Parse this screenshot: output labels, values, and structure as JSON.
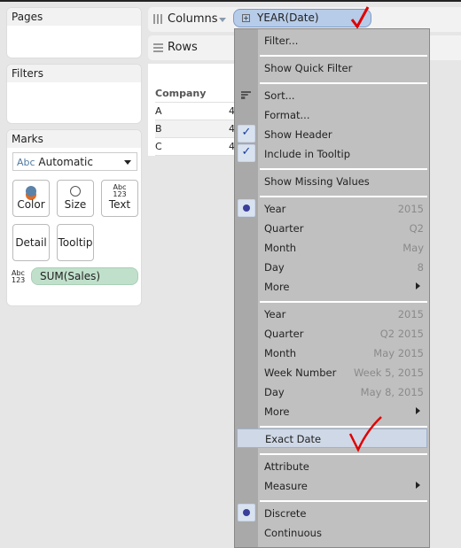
{
  "sidebar": {
    "pages": "Pages",
    "filters": "Filters",
    "marks": "Marks",
    "mark_type": "Automatic",
    "mark_type_prefix": "Abc",
    "buttons": [
      {
        "label": "Color"
      },
      {
        "label": "Size"
      },
      {
        "label": "Text",
        "icon_text": "Abc\n123"
      },
      {
        "label": "Detail"
      },
      {
        "label": "Tooltip"
      }
    ],
    "field_icon": "Abc 123",
    "field": "SUM(Sales)"
  },
  "shelves": {
    "columns": "Columns",
    "rows": "Rows",
    "column_pill": "YEAR(Date)"
  },
  "table": {
    "header": "Company",
    "rows": [
      {
        "label": "A",
        "value": "4"
      },
      {
        "label": "B",
        "value": "4"
      },
      {
        "label": "C",
        "value": "4"
      }
    ]
  },
  "menu": {
    "filter": "Filter...",
    "quick_filter": "Show Quick Filter",
    "sort": "Sort...",
    "format": "Format...",
    "show_header": "Show Header",
    "include_tooltip": "Include in Tooltip",
    "missing": "Show Missing Values",
    "parts": [
      {
        "label": "Year",
        "value": "2015"
      },
      {
        "label": "Quarter",
        "value": "Q2"
      },
      {
        "label": "Month",
        "value": "May"
      },
      {
        "label": "Day",
        "value": "8"
      },
      {
        "label": "More"
      }
    ],
    "values": [
      {
        "label": "Year",
        "value": "2015"
      },
      {
        "label": "Quarter",
        "value": "Q2 2015"
      },
      {
        "label": "Month",
        "value": "May 2015"
      },
      {
        "label": "Week Number",
        "value": "Week 5, 2015"
      },
      {
        "label": "Day",
        "value": "May 8, 2015"
      },
      {
        "label": "More"
      }
    ],
    "exact_date": "Exact Date",
    "attribute": "Attribute",
    "measure": "Measure",
    "discrete": "Discrete",
    "continuous": "Continuous"
  },
  "colors": {
    "pill": "#b7cce8",
    "measure_pill": "#c1e0cc",
    "annotation": "#e00000"
  }
}
